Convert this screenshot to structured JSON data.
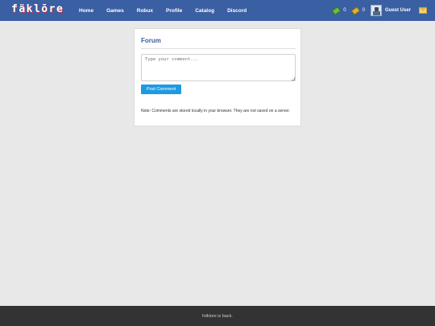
{
  "header": {
    "logo": "fäklōre",
    "nav": [
      "Home",
      "Games",
      "Robux",
      "Profile",
      "Catalog",
      "Discord"
    ],
    "robux_count": "0",
    "tix_count": "0",
    "username": "Guest User",
    "colors": {
      "bar": "#3a5fa3",
      "robux": "#6abf3f",
      "tix": "#d9b23a"
    },
    "icons": {
      "robux": "robux-icon",
      "tix": "tix-icon",
      "avatar": "avatar-icon",
      "mail": "mail-icon"
    }
  },
  "forum": {
    "title": "Forum",
    "comment_placeholder": "Type your comment...",
    "post_button": "Post Comment",
    "note": "Note: Comments are stored locally in your browser. They are not saved on a server.",
    "button_color": "#1e9ae0"
  },
  "footer": {
    "text": "folklore is back."
  }
}
